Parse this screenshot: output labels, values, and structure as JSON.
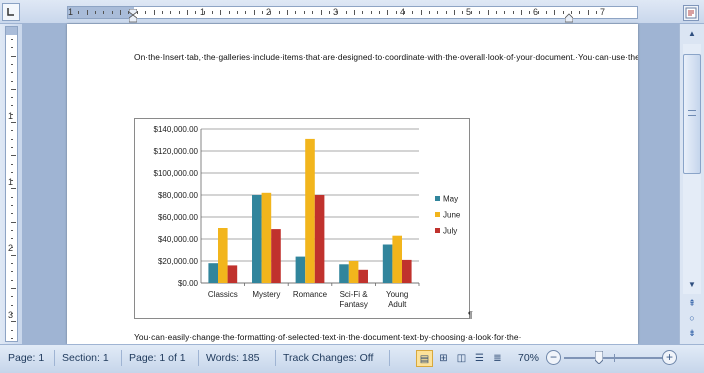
{
  "ruler": {
    "numbers": [
      "1",
      "1",
      "2",
      "3",
      "4",
      "5",
      "6",
      "7"
    ],
    "vertical_numbers": [
      "1",
      "1",
      "2",
      "3",
      "4"
    ]
  },
  "document": {
    "paragraph1": "On·the·Insert·tab,·the·galleries·include·items·that·are·designed·to·coordinate·with·the·overall·look·of·your·document.·You·can·use·these·galleries·to·insert·tables,·headers,·footers,·lists,·cover·pages,·and·other·document·building·blocks.·When·you·create·pictures,·charts,·or·diagrams,·they·also·coordinate·with·your·current·document·look.¶",
    "paragraph2": "You·can·easily·change·the·formatting·of·selected·text·in·the·document·text·by·choosing·a·look·for·the·"
  },
  "chart_data": {
    "type": "bar",
    "categories": [
      "Classics",
      "Mystery",
      "Romance",
      "Sci-Fi & Fantasy",
      "Young Adult"
    ],
    "category_lines": [
      [
        "Classics"
      ],
      [
        "Mystery"
      ],
      [
        "Romance"
      ],
      [
        "Sci-Fi &",
        "Fantasy"
      ],
      [
        "Young",
        "Adult"
      ]
    ],
    "series": [
      {
        "name": "May",
        "color": "#31859c",
        "values": [
          18000,
          80000,
          24000,
          17000,
          35000
        ]
      },
      {
        "name": "June",
        "color": "#f2b51c",
        "values": [
          50000,
          82000,
          131000,
          20000,
          43000
        ]
      },
      {
        "name": "July",
        "color": "#c0322d",
        "values": [
          16000,
          49000,
          80000,
          12000,
          21000
        ]
      }
    ],
    "ylim": [
      0,
      140000
    ],
    "yticks": [
      "$0.00",
      "$20,000.00",
      "$40,000.00",
      "$60,000.00",
      "$80,000.00",
      "$100,000.00",
      "$120,000.00",
      "$140,000.00"
    ],
    "grid": true,
    "legend_position": "right"
  },
  "statusbar": {
    "page": "Page: 1",
    "section": "Section: 1",
    "page_of": "Page: 1 of 1",
    "words": "Words: 185",
    "track_changes": "Track Changes: Off",
    "zoom": "70%",
    "zoom_level": 0.35
  },
  "icons": {
    "view_ruler": "view-ruler-icon",
    "scroll_up": "scroll-up-arrow-icon",
    "scroll_down": "scroll-down-arrow-icon",
    "prev_page": "previous-page-icon",
    "select_browse": "select-browse-object-icon",
    "next_page": "next-page-icon"
  }
}
